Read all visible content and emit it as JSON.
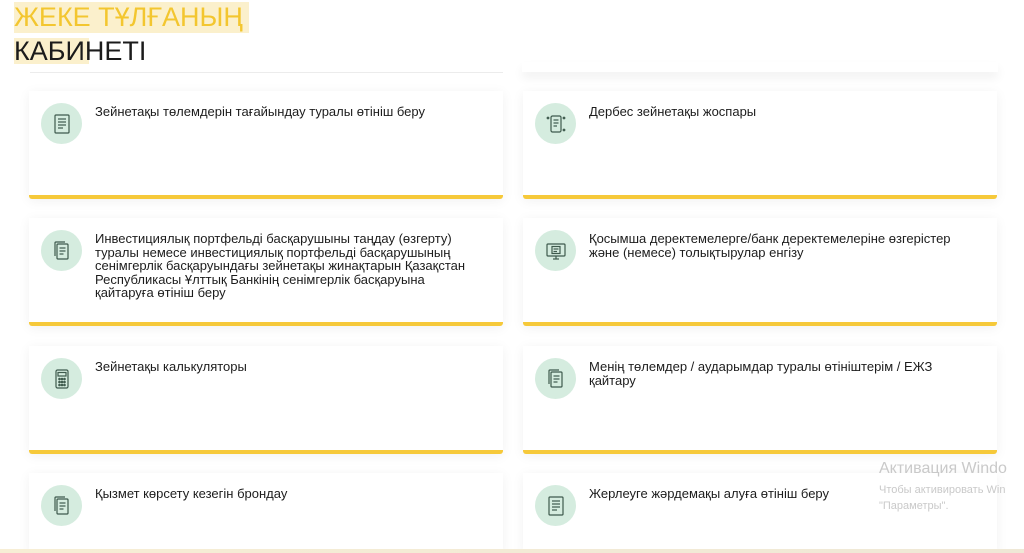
{
  "header": {
    "title_line1": "ЖЕКЕ ТҰЛҒАНЫҢ",
    "title_line2": "КАБИНЕТІ"
  },
  "cards": [
    {
      "label": "Зейнетақы төлемдерін тағайындау туралы өтініш беру",
      "icon": "document-list-icon"
    },
    {
      "label": "Дербес зейнетақы жоспары",
      "icon": "phone-document-icon"
    },
    {
      "label": "Инвестициялық портфельді басқарушыны таңдау (өзгерту) туралы немесе инвестициялық портфельді басқарушының сенімгерлік басқаруындағы зейнетақы жинақтарын Қазақстан Республикасы Ұлттық Банкінің сенімгерлік басқаруына қайтаруға өтініш беру",
      "icon": "documents-stack-icon"
    },
    {
      "label": "Қосымша деректемелерге/банк деректемелеріне өзгерістер және (немесе) толықтырулар енгізу",
      "icon": "monitor-document-icon"
    },
    {
      "label": "Зейнетақы калькуляторы",
      "icon": "calculator-icon"
    },
    {
      "label": "Менің төлемдер / аударымдар туралы өтініштерім / ЕЖЗ қайтару",
      "icon": "documents-stack-icon"
    },
    {
      "label": "Қызмет көрсету кезегін брондау",
      "icon": "documents-stack-icon"
    },
    {
      "label": "Жерлеуге жәрдемақы алуға өтініш беру",
      "icon": "document-list-icon"
    }
  ],
  "watermark": {
    "line1": "Активация Windo",
    "line2": "Чтобы активировать Win",
    "line3": "\"Параметры\"."
  },
  "colors": {
    "accent": "#f6c93a",
    "icon_bg": "#d5ecdf",
    "icon_stroke": "#3e5a4d"
  }
}
